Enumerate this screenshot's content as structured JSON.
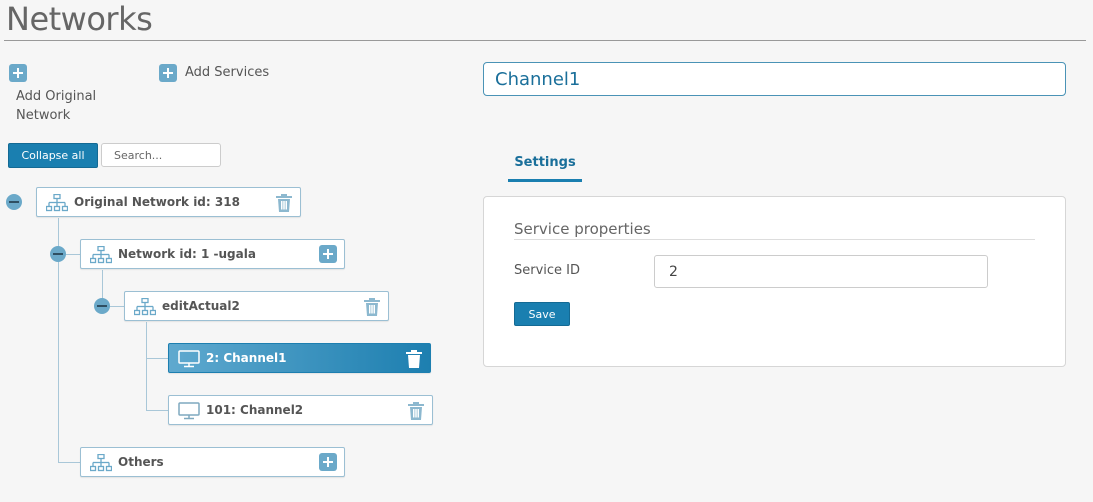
{
  "page": {
    "title": "Networks"
  },
  "toolbar": {
    "add_original_network_label": "Add Original Network",
    "add_services_label": "Add Services",
    "collapse_all_label": "Collapse all",
    "search_placeholder": "Search..."
  },
  "tree": {
    "nodes": [
      {
        "label": "Original Network id: 318",
        "icon": "network-icon",
        "action": "delete",
        "expanded": true,
        "level": 0
      },
      {
        "label": "Network id: 1 -ugala",
        "icon": "network-icon",
        "action": "add",
        "expanded": true,
        "level": 1
      },
      {
        "label": "editActual2",
        "icon": "network-icon",
        "action": "delete",
        "expanded": true,
        "level": 2
      },
      {
        "label": "2: Channel1",
        "icon": "monitor-icon",
        "action": "delete",
        "selected": true,
        "level": 3
      },
      {
        "label": "101: Channel2",
        "icon": "monitor-icon",
        "action": "delete",
        "level": 3
      },
      {
        "label": "Others",
        "icon": "network-icon",
        "action": "add",
        "level": 1
      }
    ]
  },
  "detail": {
    "name_value": "Channel1",
    "tabs": [
      {
        "label": "Settings",
        "active": true
      }
    ],
    "panel_title": "Service properties",
    "service_id_label": "Service ID",
    "service_id_value": "2",
    "save_label": "Save"
  },
  "colors": {
    "accent": "#1a7fb0",
    "tree_border": "#9bbfd3",
    "icon_blue": "#6ba9c9"
  }
}
